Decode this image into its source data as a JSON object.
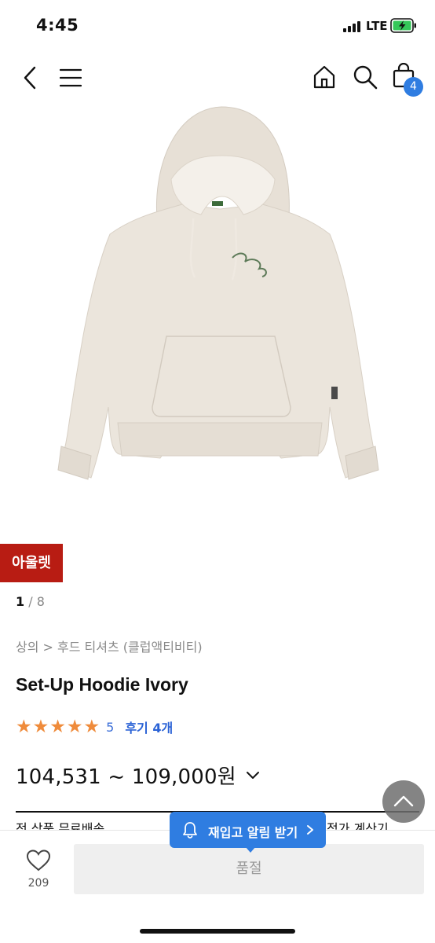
{
  "status_bar": {
    "time": "4:45",
    "network": "LTE"
  },
  "nav": {
    "cart_count": "4"
  },
  "product": {
    "badge": "아울렛",
    "pager_current": "1",
    "pager_total": " / 8",
    "breadcrumb": "상의 > 후드 티셔츠 (클럽액티비티)",
    "title": "Set-Up Hoodie Ivory",
    "rating": {
      "stars": [
        "★",
        "★",
        "★",
        "★",
        "★"
      ],
      "value": "5",
      "reviews": "후기 4개"
    },
    "price": "104,531 ~ 109,000원",
    "shipping_left": "전 상품 무료배송",
    "shipping_right": "적가 계산기"
  },
  "bottom": {
    "like_count": "209",
    "soldout_label": "품절",
    "restock_label": "재입고 알림 받기"
  },
  "colors": {
    "accent_blue": "#2f7de1",
    "outlet_red": "#b81c13",
    "star_orange": "#ef8b3b"
  },
  "icons": [
    "back-icon",
    "menu-icon",
    "home-icon",
    "search-icon",
    "cart-icon",
    "bell-icon",
    "heart-icon",
    "chevron-down-icon",
    "chevron-up-icon",
    "chevron-right-icon"
  ]
}
